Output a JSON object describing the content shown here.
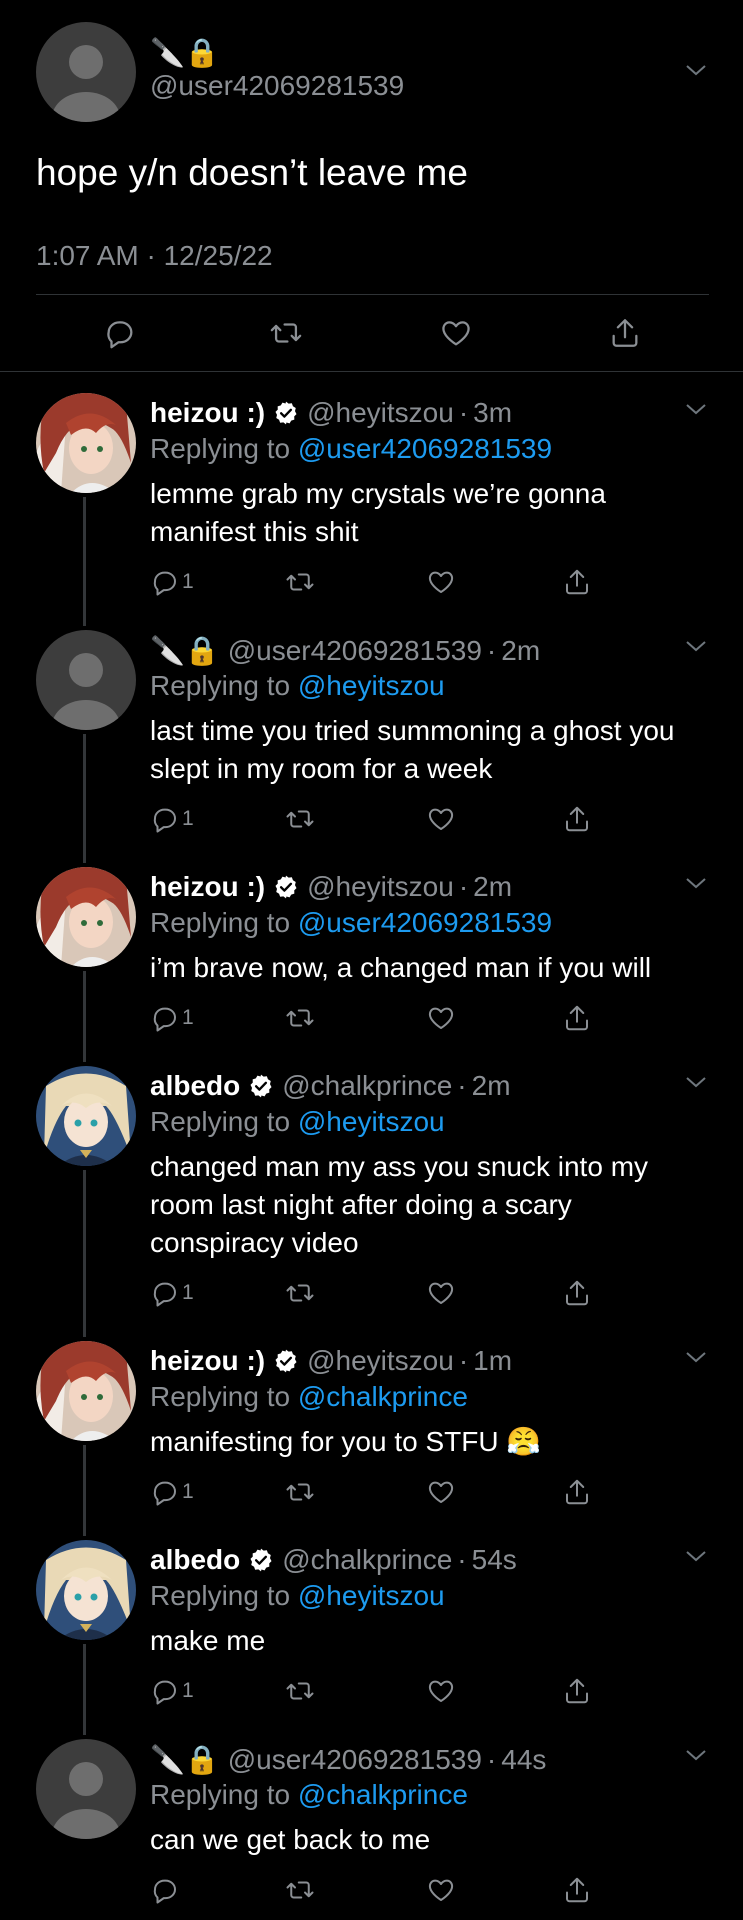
{
  "main_tweet": {
    "emoji_prefix": "🔪🔒",
    "handle": "@user42069281539",
    "text": "hope y/n doesn’t leave me",
    "meta": "1:07 AM · 12/25/22"
  },
  "replies": [
    {
      "name": "heizou :)",
      "handle": "@heyitszou",
      "time": "3m",
      "verified": true,
      "replying_label": "Replying to",
      "replying_to": "@user42069281539",
      "text": "lemme grab my crystals we’re gonna manifest this shit",
      "reply_count": "1",
      "avatar": "heizou"
    },
    {
      "name": "",
      "emoji_prefix": "🔪🔒",
      "handle": "@user42069281539",
      "time": "2m",
      "verified": false,
      "replying_label": "Replying to",
      "replying_to": "@heyitszou",
      "text": "last time you tried summoning a ghost you slept in my room for a week",
      "reply_count": "1",
      "avatar": "default"
    },
    {
      "name": "heizou :)",
      "handle": "@heyitszou",
      "time": "2m",
      "verified": true,
      "replying_label": "Replying to",
      "replying_to": "@user42069281539",
      "text": "i’m brave now, a changed man if you will",
      "reply_count": "1",
      "avatar": "heizou"
    },
    {
      "name": "albedo",
      "handle": "@chalkprince",
      "time": "2m",
      "verified": true,
      "replying_label": "Replying to",
      "replying_to": "@heyitszou",
      "text": "changed man my ass you snuck into my room last night after doing a scary conspiracy video",
      "reply_count": "1",
      "avatar": "albedo"
    },
    {
      "name": "heizou :)",
      "handle": "@heyitszou",
      "time": "1m",
      "verified": true,
      "replying_label": "Replying to",
      "replying_to": "@chalkprince",
      "text": "manifesting for you to STFU 😤",
      "reply_count": "1",
      "avatar": "heizou"
    },
    {
      "name": "albedo",
      "handle": "@chalkprince",
      "time": "54s",
      "verified": true,
      "replying_label": "Replying to",
      "replying_to": "@heyitszou",
      "text": "make me",
      "reply_count": "1",
      "avatar": "albedo"
    },
    {
      "name": "",
      "emoji_prefix": "🔪🔒",
      "handle": "@user42069281539",
      "time": "44s",
      "verified": false,
      "replying_label": "Replying to",
      "replying_to": "@chalkprince",
      "text": "can we get back to me",
      "reply_count": "",
      "avatar": "default"
    }
  ],
  "dot_separator": "·",
  "colors": {
    "background": "#000000",
    "text": "#ffffff",
    "secondary": "#8b8f94",
    "link": "#1d9bf0",
    "divider": "#2f3336"
  },
  "icons": [
    "chevron-down-icon",
    "comment-icon",
    "retweet-icon",
    "like-icon",
    "share-icon",
    "verified-badge-icon",
    "knife-emoji",
    "lock-emoji"
  ]
}
